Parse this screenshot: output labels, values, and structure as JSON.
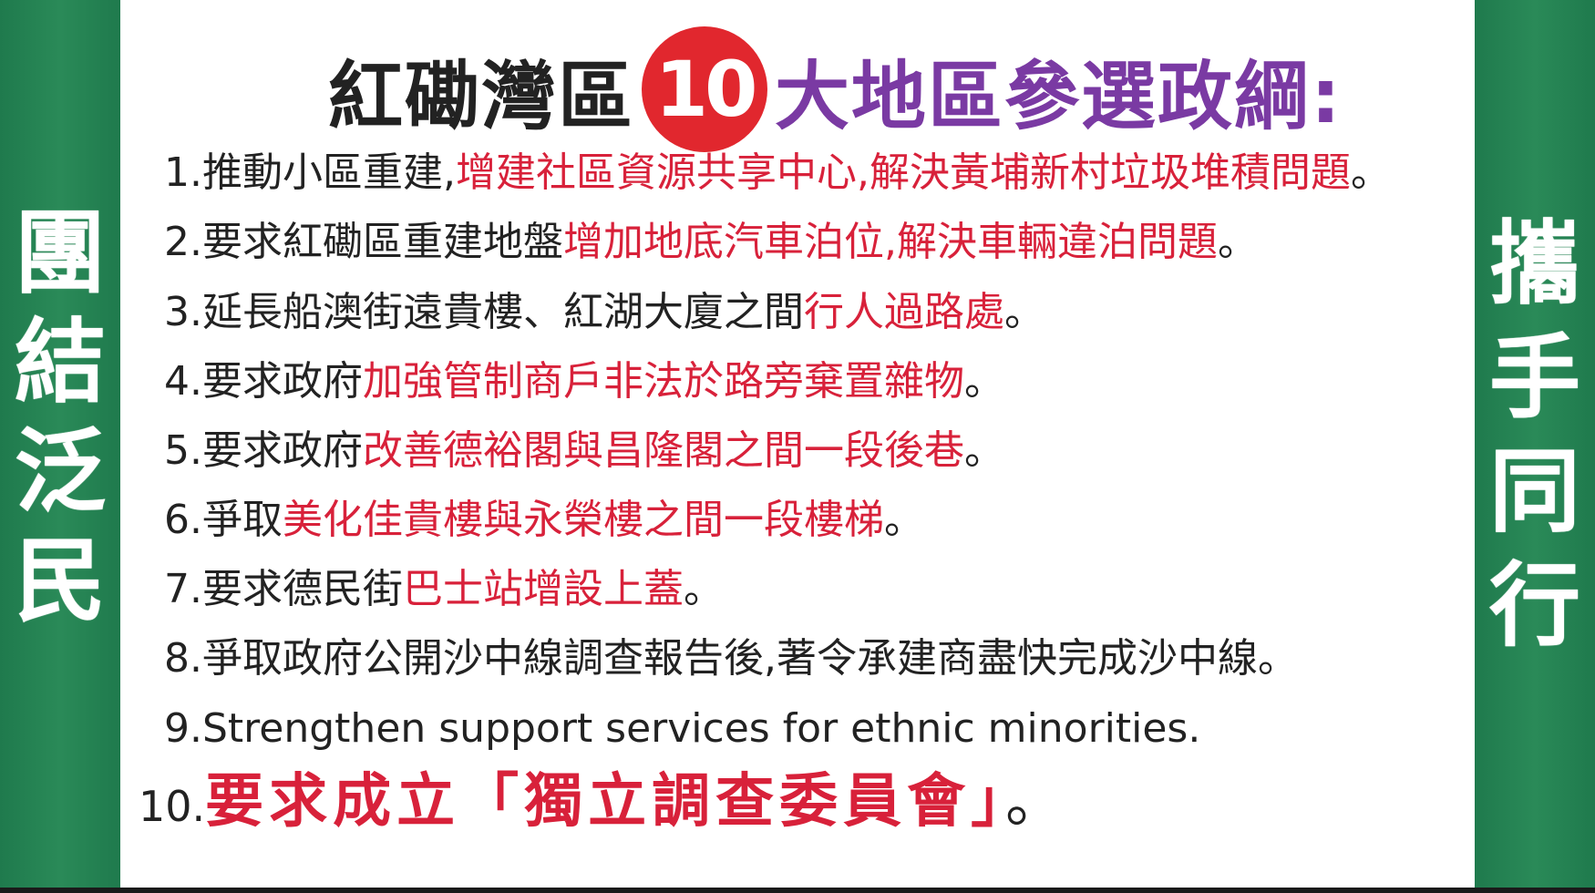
{
  "title": {
    "part1": "紅磡灣區",
    "number": "10",
    "part2": "大地區參選政綱:"
  },
  "left_slogan": [
    "團",
    "結",
    "泛",
    "民"
  ],
  "right_slogan": [
    "攜",
    "手",
    "同",
    "行"
  ],
  "items": [
    {
      "num": "1.",
      "black": "推動小區重建,",
      "red": "增建社區資源共享中心,解決黃埔新村垃圾堆積問題",
      "end": "。"
    },
    {
      "num": "2.",
      "black": "要求紅磡區重建地盤",
      "red": "增加地底汽車泊位,解決車輛違泊問題",
      "end": "。"
    },
    {
      "num": "3.",
      "black": "延長船澳街遠貴樓、紅湖大廈之間",
      "red": "行人過路處",
      "end": "。"
    },
    {
      "num": "4.",
      "black": "要求政府",
      "red": "加強管制商戶非法於路旁棄置雜物",
      "end": "。"
    },
    {
      "num": "5.",
      "black": "要求政府",
      "red": "改善德裕閣與昌隆閣之間一段後巷",
      "end": "。"
    },
    {
      "num": "6.",
      "black": "爭取",
      "red": "美化佳貴樓與永榮樓之間一段樓梯",
      "end": "。"
    },
    {
      "num": "7.",
      "black": "要求德民街",
      "red": "巴士站增設上蓋",
      "end": "。"
    },
    {
      "num": "8.",
      "black": "爭取政府公開沙中線調查報告後,著令承建商盡快完成沙中線",
      "red": "",
      "end": "。"
    },
    {
      "num": "9.",
      "black": "Strengthen support services for ethnic minorities.",
      "red": "",
      "end": ""
    },
    {
      "num": "10.",
      "black": "",
      "red": "要求成立「獨立調查委員會」",
      "end": "。"
    }
  ],
  "colors": {
    "green": "#1f7a4d",
    "red": "#d8213a",
    "purple": "#7a3aa3",
    "badge": "#e1272e"
  }
}
